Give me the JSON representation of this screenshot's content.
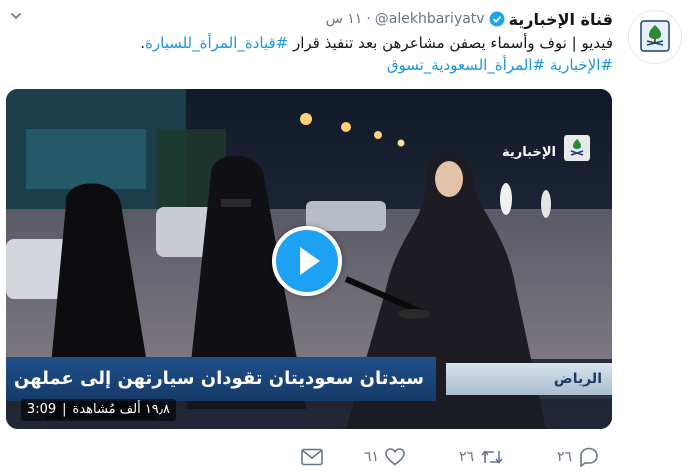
{
  "tweet": {
    "display_name": "قناة الإخبارية",
    "handle": "@alekhbariyatv",
    "separator": "·",
    "time": "١١ س",
    "text_line1": "فيديو | نوف وأسماء يصفن مشاعرهن بعد تنفيذ قرار ",
    "hashtag1": "#قيادة_المرأة_للسيارة",
    "text_line1_end": ".",
    "hashtag2": "#الإخبارية",
    "hashtag3": "#المرأة_السعودية_تسوق"
  },
  "media": {
    "duration": "3:09",
    "views": "١٩٫٨ ألف مُشاهدة",
    "ticker_main": "سيدتان سعوديتان تقودان سيارتهن إلى عملهن",
    "ticker_location": "الرياض",
    "channel_logo": "الإخبارية"
  },
  "actions": {
    "reply_count": "٢٦",
    "retweet_count": "٢٦",
    "like_count": "٦١"
  },
  "colors": {
    "link": "#1b95e0",
    "accent": "#1da1f2",
    "muted": "#657786"
  },
  "icons": [
    "chevron-down-icon",
    "verified-badge-icon",
    "play-icon",
    "reply-icon",
    "retweet-icon",
    "like-icon",
    "message-icon"
  ]
}
